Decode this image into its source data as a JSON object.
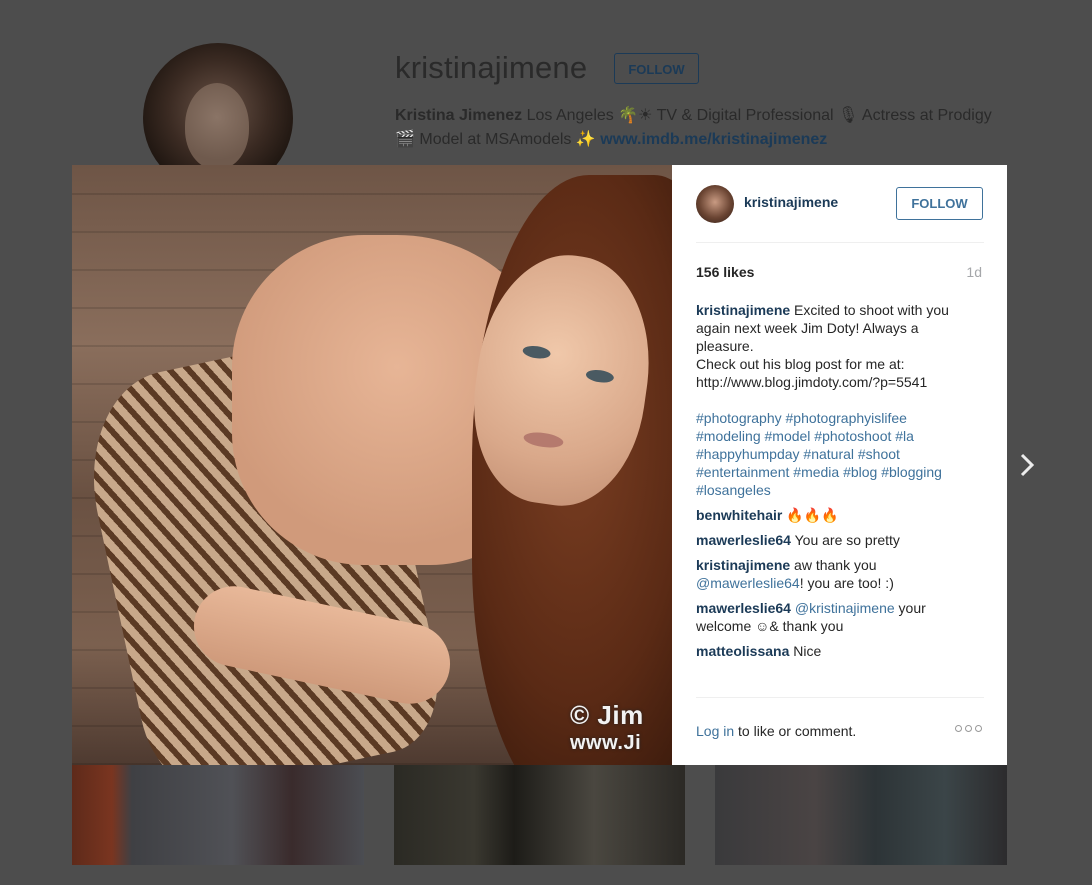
{
  "background_profile": {
    "username": "kristinajimene",
    "follow_label": "FOLLOW",
    "bio_name": "Kristina Jimenez",
    "bio_text_1": " Los Angeles 🌴☀ TV & Digital Professional 🎙 Actress at Prodigy",
    "bio_text_2": "🎬 Model at MSAmodels ✨ ",
    "bio_link": "www.imdb.me/kristinajimenez"
  },
  "post": {
    "username": "kristinajimene",
    "follow_label": "FOLLOW",
    "likes": "156 likes",
    "time_ago": "1d",
    "watermark_line1": "© Jim",
    "watermark_line2": "www.Ji",
    "caption": {
      "user": "kristinajimene",
      "lines": [
        " Excited to shoot with you",
        "again next week Jim Doty! Always a",
        "pleasure.",
        "Check out his blog post for me at:",
        "http://www.blog.jimdoty.com/?p=5541"
      ],
      "hashtag_lines": [
        "#photography #photographyislifee",
        "#modeling #model #photoshoot #la",
        "#happyhumpday #natural #shoot",
        "#entertainment #media #blog #blogging",
        "#losangeles"
      ]
    },
    "comments": [
      {
        "user": "benwhitehair",
        "text": " 🔥🔥🔥"
      },
      {
        "user": "mawerleslie64",
        "text": " You are so pretty"
      },
      {
        "user": "kristinajimene",
        "text": " aw thank you ",
        "mention": "@mawerleslie64",
        "text2": "! you are too! :)"
      },
      {
        "user": "mawerleslie64",
        "mention": " @kristinajimene",
        "text": " your welcome ☺& thank you"
      },
      {
        "user": "matteolissana",
        "text": " Nice"
      }
    ],
    "login_link": "Log in",
    "login_text": " to like or comment."
  },
  "icons": {
    "next": "chevron-right-icon",
    "more": "more-options-icon"
  },
  "colors": {
    "link": "#1b3a57",
    "hashtag": "#3f729b",
    "overlay": "#4d4d4d"
  }
}
